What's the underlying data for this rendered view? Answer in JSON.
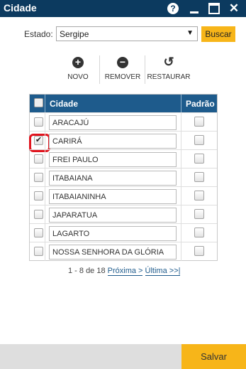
{
  "window": {
    "title": "Cidade",
    "help_glyph": "?",
    "close_glyph": "✕",
    "icons": [
      "help-icon",
      "minimize-icon",
      "maximize-icon",
      "close-icon"
    ]
  },
  "filter": {
    "estado_label": "Estado:",
    "estado_value": "Sergipe",
    "buscar_label": "Buscar"
  },
  "toolbar": {
    "novo_label": "NOVO",
    "remover_label": "REMOVER",
    "restaurar_label": "RESTAURAR",
    "novo_glyph": "+",
    "remover_glyph": "−",
    "restaurar_glyph": "↺"
  },
  "grid": {
    "columns": [
      "Cidade",
      "Padrão"
    ],
    "rows": [
      {
        "cidade": "ARACAJÚ",
        "selected": false,
        "padrao": false
      },
      {
        "cidade": "CARIRÁ",
        "selected": true,
        "padrao": false
      },
      {
        "cidade": "FREI PAULO",
        "selected": false,
        "padrao": false
      },
      {
        "cidade": "ITABAIANA",
        "selected": false,
        "padrao": false
      },
      {
        "cidade": "ITABAIANINHA",
        "selected": false,
        "padrao": false
      },
      {
        "cidade": "JAPARATUA",
        "selected": false,
        "padrao": false
      },
      {
        "cidade": "LAGARTO",
        "selected": false,
        "padrao": false
      },
      {
        "cidade": "NOSSA SENHORA DA GLÓRIA",
        "selected": false,
        "padrao": false
      }
    ],
    "check_glyph": "✔"
  },
  "pager": {
    "range": "1 - 8 de 18",
    "next_label": "Próxima >",
    "last_label": "Última >>|"
  },
  "footer": {
    "salvar_label": "Salvar"
  },
  "colors": {
    "titlebar": "#0c3a5f",
    "grid_header": "#1e5b8c",
    "accent_button": "#f7b519",
    "highlight": "#e0141e"
  }
}
